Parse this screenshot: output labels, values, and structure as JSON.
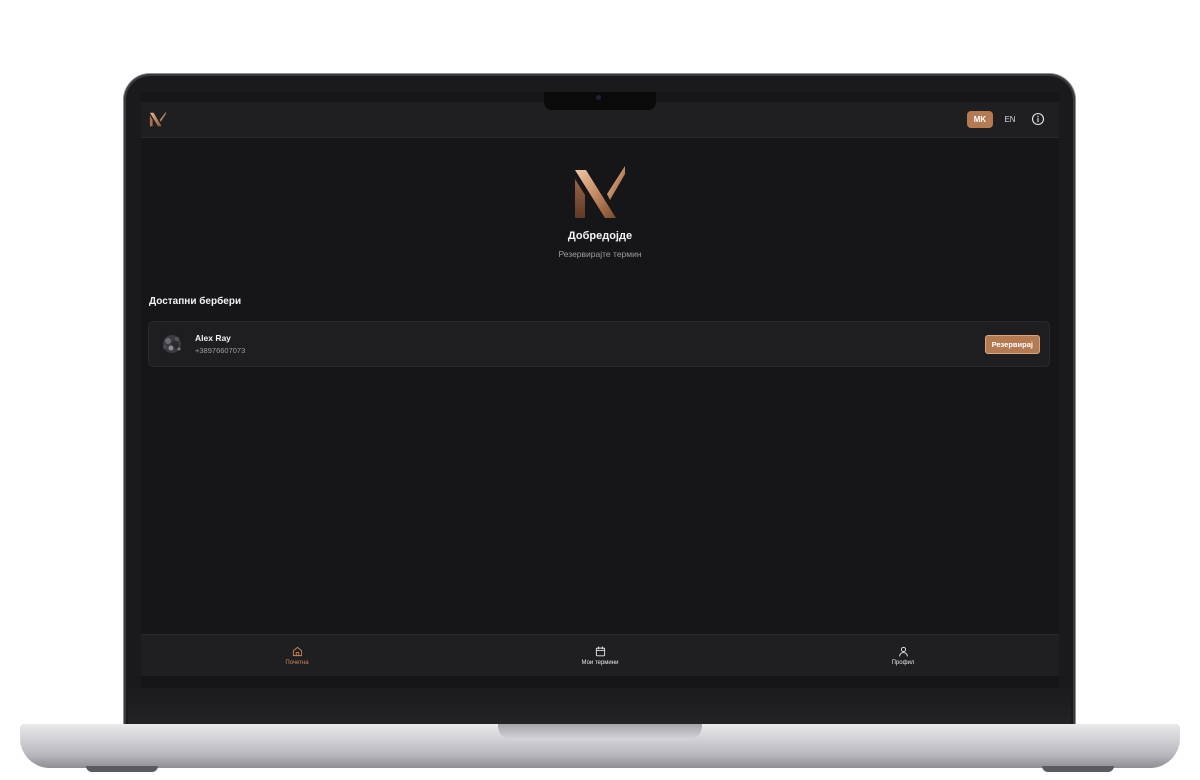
{
  "header": {
    "languages": [
      {
        "code": "MK",
        "label": "MK",
        "active": true
      },
      {
        "code": "EN",
        "label": "EN",
        "active": false
      }
    ],
    "info_icon": "info-icon",
    "logo_icon": "brand-logo-icon"
  },
  "hero": {
    "title": "Добредојде",
    "subtitle": "Резервирајте термин"
  },
  "barbers_section": {
    "title": "Достапни бербери",
    "items": [
      {
        "name": "Alex Ray",
        "phone": "+38976607073",
        "book_label": "Резервирај"
      }
    ]
  },
  "bottom_nav": {
    "items": [
      {
        "label": "Почетна",
        "icon": "home-icon",
        "active": true
      },
      {
        "label": "Мои термини",
        "icon": "calendar-icon",
        "active": false
      },
      {
        "label": "Профил",
        "icon": "user-icon",
        "active": false
      }
    ]
  },
  "colors": {
    "accent": "#b47a52",
    "background": "#161618",
    "surface": "#1e1e21",
    "text_primary": "#f3f3f5",
    "text_secondary": "#9c9ca3"
  }
}
